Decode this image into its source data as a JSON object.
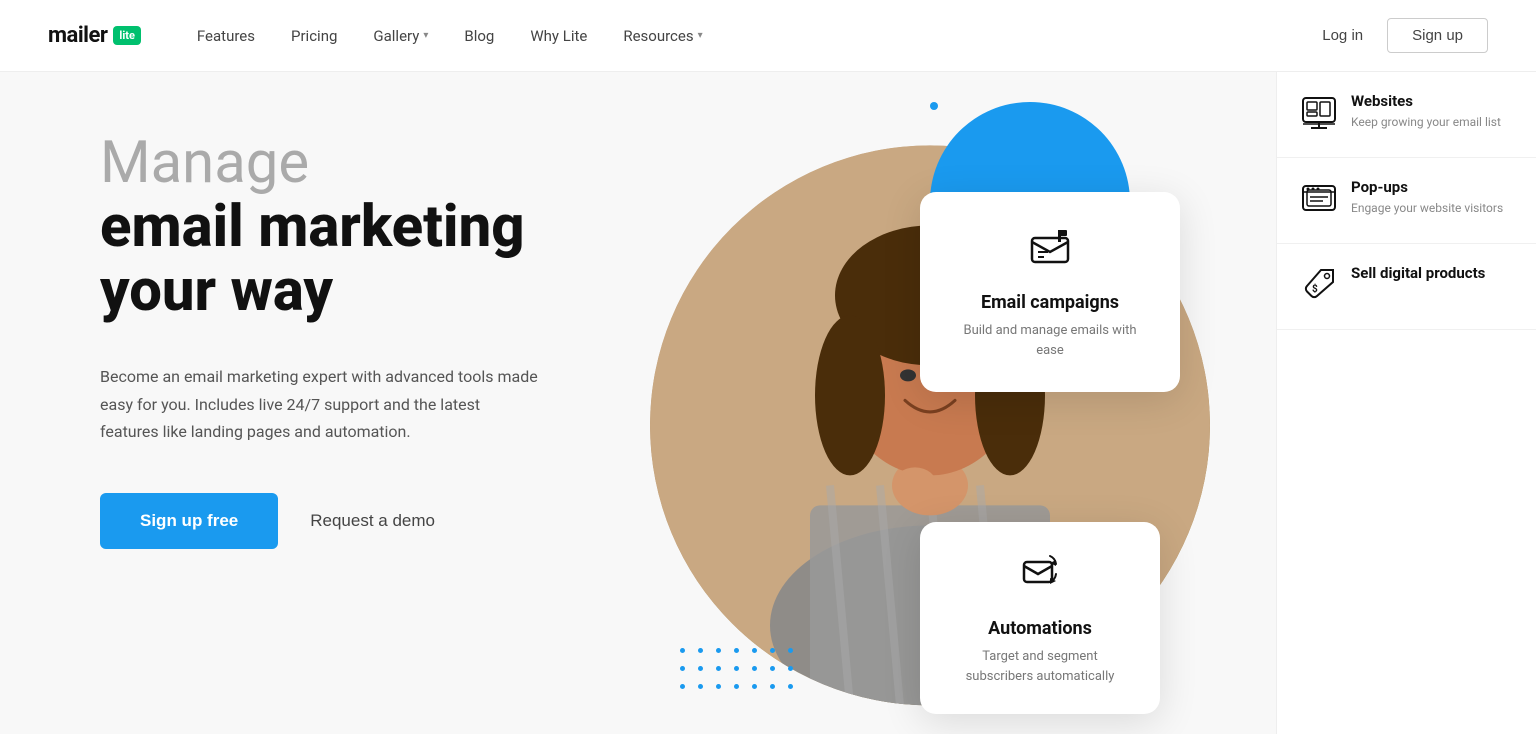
{
  "nav": {
    "logo_text": "mailer",
    "logo_badge": "lite",
    "links": [
      {
        "label": "Features",
        "has_chevron": false
      },
      {
        "label": "Pricing",
        "has_chevron": false
      },
      {
        "label": "Gallery",
        "has_chevron": true
      },
      {
        "label": "Blog",
        "has_chevron": false
      },
      {
        "label": "Why Lite",
        "has_chevron": false
      },
      {
        "label": "Resources",
        "has_chevron": true
      }
    ],
    "login_label": "Log in",
    "signup_label": "Sign up"
  },
  "hero": {
    "title_gray": "Manage",
    "title_bold_line1": "email marketing",
    "title_bold_line2": "your way",
    "subtitle": "Become an email marketing expert with advanced tools made easy for you. Includes live 24/7 support and the latest features like landing pages and automation.",
    "cta_primary": "Sign up free",
    "cta_secondary": "Request a demo"
  },
  "dot_top": "•",
  "cards": {
    "email": {
      "title": "Email campaigns",
      "desc": "Build and manage emails with ease"
    },
    "auto": {
      "title": "Automations",
      "desc": "Target and segment subscribers automatically"
    }
  },
  "sidebar": {
    "items": [
      {
        "title": "Websites",
        "desc": "Keep growing your email list"
      },
      {
        "title": "Pop-ups",
        "desc": "Engage your website visitors"
      },
      {
        "title": "Sell digital products",
        "desc": ""
      }
    ]
  }
}
